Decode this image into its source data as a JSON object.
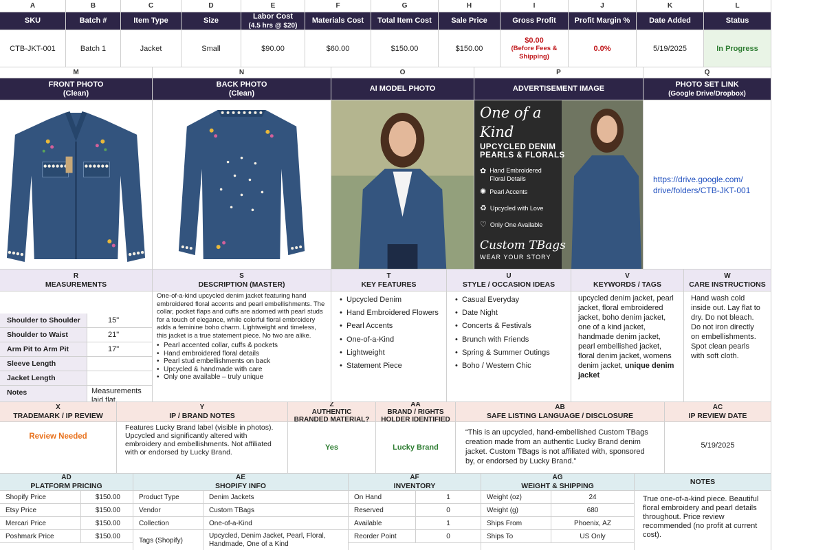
{
  "top": {
    "letters": [
      "A",
      "B",
      "C",
      "D",
      "E",
      "F",
      "G",
      "H",
      "I",
      "J",
      "K",
      "L"
    ],
    "headers": [
      {
        "main": "SKU",
        "sub": ""
      },
      {
        "main": "Batch #",
        "sub": ""
      },
      {
        "main": "Item Type",
        "sub": ""
      },
      {
        "main": "Size",
        "sub": ""
      },
      {
        "main": "Labor Cost",
        "sub": "(4.5 hrs @ $20)"
      },
      {
        "main": "Materials Cost",
        "sub": ""
      },
      {
        "main": "Total Item Cost",
        "sub": ""
      },
      {
        "main": "Sale Price",
        "sub": ""
      },
      {
        "main": "Gross Profit",
        "sub": ""
      },
      {
        "main": "Profit Margin %",
        "sub": ""
      },
      {
        "main": "Date Added",
        "sub": ""
      },
      {
        "main": "Status",
        "sub": ""
      }
    ],
    "values": {
      "sku": "CTB-JKT-001",
      "batch": "Batch 1",
      "item_type": "Jacket",
      "size": "Small",
      "labor_cost": "$90.00",
      "materials_cost": "$60.00",
      "total_cost": "$150.00",
      "sale_price": "$150.00",
      "gross_profit": "$0.00",
      "gross_profit_note": "(Before Fees & Shipping)",
      "profit_margin": "0.0%",
      "date_added": "5/19/2025",
      "status": "In Progress"
    }
  },
  "photos": {
    "letters": [
      "M",
      "N",
      "O",
      "P",
      "Q"
    ],
    "headers": [
      {
        "main": "FRONT PHOTO",
        "sub": "(Clean)"
      },
      {
        "main": "BACK PHOTO",
        "sub": "(Clean)"
      },
      {
        "main": "AI MODEL PHOTO",
        "sub": ""
      },
      {
        "main": "ADVERTISEMENT IMAGE",
        "sub": ""
      },
      {
        "main": "PHOTO SET LINK",
        "sub": "(Google Drive/Dropbox)"
      }
    ],
    "link": "https://drive.google.com/ drive/folders/CTB-JKT-001",
    "ad": {
      "title": "One of a Kind",
      "subtitle1": "UPCYCLED DENIM",
      "subtitle2": "PEARLS & FLORALS",
      "features": [
        "Hand Embroidered Floral Details",
        "Pearl Accents",
        "Upcycled with Love",
        "Only One Available"
      ],
      "brand": "Custom TBags",
      "tagline": "WEAR YOUR STORY"
    }
  },
  "details": {
    "letters": [
      "R",
      "S",
      "T",
      "U",
      "V",
      "W"
    ],
    "headers": [
      "MEASUREMENTS",
      "DESCRIPTION (MASTER)",
      "KEY FEATURES",
      "STYLE / OCCASION IDEAS",
      "KEYWORDS / TAGS",
      "CARE INSTRUCTIONS"
    ],
    "measurements": [
      {
        "label": "Shoulder to Shoulder",
        "value": "15\""
      },
      {
        "label": "Shoulder to Waist",
        "value": "21\""
      },
      {
        "label": "Arm Pit to Arm Pit",
        "value": "17\""
      },
      {
        "label": "Sleeve Length",
        "value": ""
      },
      {
        "label": "Jacket Length",
        "value": ""
      }
    ],
    "notes_label": "Notes",
    "notes_value": "Measurements laid flat.",
    "description": "One-of-a-kind upcycled denim jacket featuring hand embroidered floral accents and pearl embellishments. The collar, pocket flaps and cuffs are adorned with pearl studs for a touch of elegance, while colorful floral embroidery adds a feminine boho charm. Lightweight and timeless, this jacket is a true statement piece. No two are alike.",
    "description_bullets": [
      "Pearl accented collar, cuffs & pockets",
      "Hand embroidered floral details",
      "Pearl stud embellishments on back",
      "Upcycled & handmade with care",
      "Only one available – truly unique"
    ],
    "key_features": [
      "Upcycled Denim",
      "Hand Embroidered Flowers",
      "Pearl Accents",
      "One-of-a-Kind",
      "Lightweight",
      "Statement Piece"
    ],
    "style_ideas": [
      "Casual Everyday",
      "Date Night",
      "Concerts & Festivals",
      "Brunch with Friends",
      "Spring & Summer Outings",
      "Boho / Western Chic"
    ],
    "keywords": "upcycled denim jacket, pearl jacket, floral embroidered jacket, boho denim jacket, one of a kind jacket, handmade denim jacket, pearl embellished jacket, floral denim jacket, womens denim jacket,",
    "keywords_bold": "unique denim jacket",
    "care": "Hand wash cold inside out. Lay flat to dry. Do not bleach. Do not iron directly on embellishments. Spot clean pearls with soft cloth."
  },
  "ip": {
    "letters": [
      "X",
      "Y",
      "Z",
      "AA",
      "AB",
      "AC"
    ],
    "headers": [
      {
        "main": "TRADEMARK / IP REVIEW",
        "sub": ""
      },
      {
        "main": "IP / BRAND NOTES",
        "sub": ""
      },
      {
        "main": "AUTHENTIC",
        "sub": "BRANDED MATERIAL?"
      },
      {
        "main": "BRAND / RIGHTS",
        "sub": "HOLDER IDENTIFIED"
      },
      {
        "main": "SAFE LISTING LANGUAGE / DISCLOSURE",
        "sub": ""
      },
      {
        "main": "IP REVIEW DATE",
        "sub": ""
      }
    ],
    "review_status": "Review Needed",
    "brand_notes": "Features Lucky Brand label (visible in photos). Upcycled and significantly altered with embroidery and embellishments. Not affiliated with or endorsed by Lucky Brand.",
    "authentic": "Yes",
    "rights_holder": "Lucky Brand",
    "disclosure": "“This is an upcycled, hand-embellished Custom TBags creation made from an authentic Lucky Brand denim jacket. Custom TBags is not affiliated with, sponsored by, or endorsed by Lucky Brand.”",
    "review_date": "5/19/2025"
  },
  "bottom": {
    "letters": [
      "AD",
      "AE",
      "AF",
      "AG",
      ""
    ],
    "headers": [
      "PLATFORM PRICING",
      "SHOPIFY INFO",
      "INVENTORY",
      "WEIGHT & SHIPPING",
      "NOTES"
    ],
    "pricing": [
      {
        "k": "Shopify Price",
        "v": "$150.00"
      },
      {
        "k": "Etsy Price",
        "v": "$150.00"
      },
      {
        "k": "Mercari Price",
        "v": "$150.00"
      },
      {
        "k": "Poshmark Price",
        "v": "$150.00"
      }
    ],
    "shopify": [
      {
        "k": "Product Type",
        "v": "Denim Jackets"
      },
      {
        "k": "Vendor",
        "v": "Custom TBags"
      },
      {
        "k": "Collection",
        "v": "One-of-a-Kind"
      },
      {
        "k": "Tags (Shopify)",
        "v": "Upcycled, Denim Jacket, Pearl, Floral, Handmade, One of a Kind"
      }
    ],
    "inventory": [
      {
        "k": "On Hand",
        "v": "1"
      },
      {
        "k": "Reserved",
        "v": "0"
      },
      {
        "k": "Available",
        "v": "1"
      },
      {
        "k": "Reorder Point",
        "v": "0"
      }
    ],
    "shipping": [
      {
        "k": "Weight (oz)",
        "v": "24"
      },
      {
        "k": "Weight (g)",
        "v": "680"
      },
      {
        "k": "Ships From",
        "v": "Phoenix, AZ"
      },
      {
        "k": "Ships To",
        "v": "US Only"
      }
    ],
    "notes": "True one-of-a-kind piece. Beautiful floral embroidery and pearl details throughout. Price review recommended (no profit at current cost)."
  },
  "colors": {
    "header": "#2d2547",
    "accent_red": "#c0171b",
    "accent_green": "#2e7d32",
    "review_orange": "#e8711c",
    "link_blue": "#1f4fbf"
  }
}
